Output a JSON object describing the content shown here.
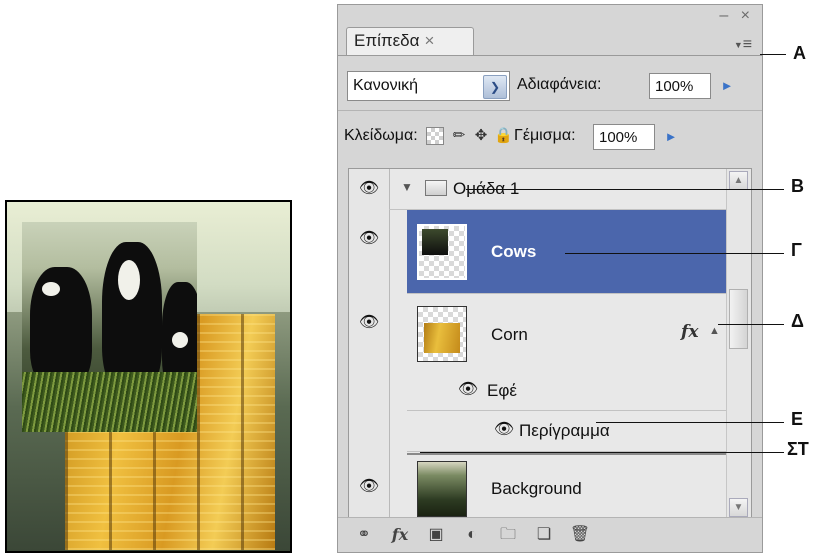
{
  "panel": {
    "tab_title": "Επίπεδα",
    "tab_close": "×",
    "window_controls": "– ×",
    "blend_mode": "Κανονική",
    "opacity_label": "Αδιαφάνεια:",
    "opacity_value": "100%",
    "lock_label": "Κλείδωμα:",
    "fill_label": "Γέμισμα:",
    "fill_value": "100%"
  },
  "layers": [
    {
      "name": "Ομάδα 1",
      "type": "group"
    },
    {
      "name": "Cows",
      "type": "layer",
      "selected": true
    },
    {
      "name": "Corn",
      "type": "layer",
      "fx": "fx"
    },
    {
      "name": "Εφέ",
      "type": "effects-header"
    },
    {
      "name": "Περίγραμμα",
      "type": "effect"
    },
    {
      "name": "Background",
      "type": "layer"
    }
  ],
  "callouts": [
    "A",
    "B",
    "Γ",
    "Δ",
    "E",
    "ΣΤ"
  ],
  "toolbar": {
    "icons": [
      "link-icon",
      "fx-icon",
      "mask-icon",
      "adjustment-icon",
      "folder-icon",
      "new-layer-icon",
      "trash-icon"
    ],
    "fx_label": "fx"
  },
  "colors": {
    "selected_row": "#4b66ac",
    "panel_bg": "#d6d6d6",
    "accent_arrow": "#3a73c8"
  }
}
